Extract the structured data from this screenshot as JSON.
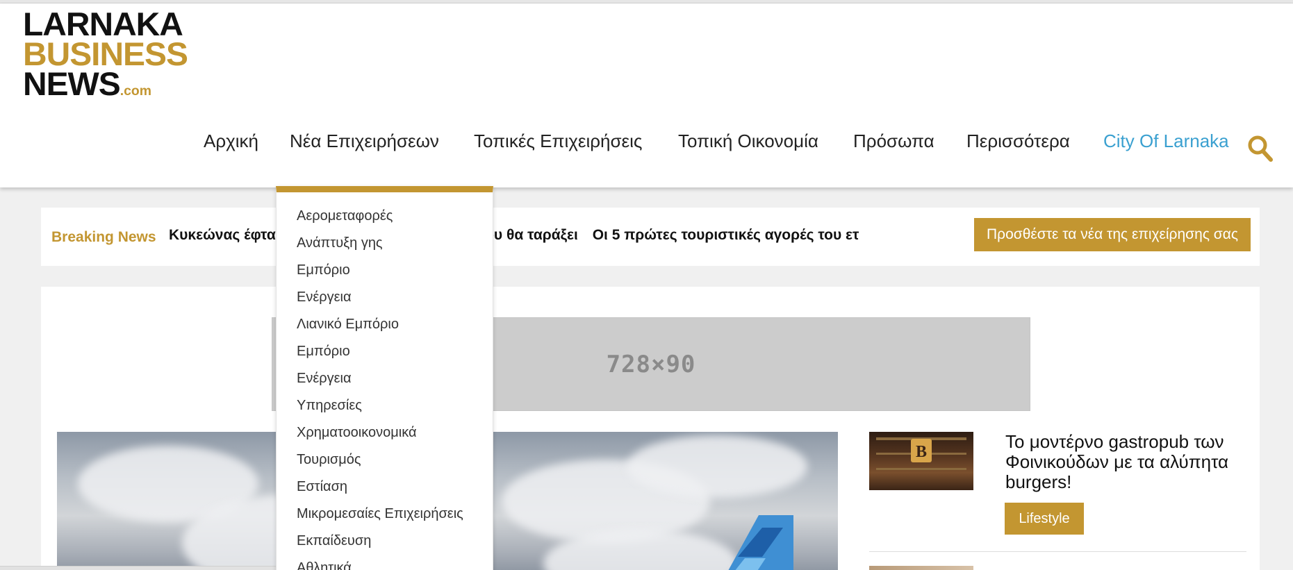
{
  "logo": {
    "line1": "LARNAKA",
    "line2": "BUSINESS",
    "line3": "NEWS",
    "suffix": ".com"
  },
  "nav": {
    "items": [
      "Αρχική",
      "Νέα Επιχειρήσεων",
      "Τοπικές Επιχειρήσεις",
      "Τοπική Οικονομία",
      "Πρόσωπα",
      "Περισσότερα",
      "City Of Larnaka"
    ],
    "search_icon": "search-icon"
  },
  "dropdown": {
    "items": [
      "Αερομεταφορές",
      "Ανάπτυξη γης",
      "Εμπόριο",
      "Ενέργεια",
      "Λιανικό Εμπόριο",
      "Εμπόριο",
      "Ενέργεια",
      "Υπηρεσίες",
      "Χρηματοοικονομικά",
      "Τουρισμός",
      "Εστίαση",
      "Μικρομεσαίες Επιχειρήσεις",
      "Εκπαίδευση",
      "Αθλητικά"
    ]
  },
  "breaking": {
    "label": "Breaking News",
    "headlines": [
      "Κυκεώνας έφτα",
      "έα άφιξη που θα ταράξει",
      "Οι 5 πρώτες τουριστικές αγορές του ετ"
    ],
    "add_button": "Προσθέστε τα νέα της επιχείρησης σας"
  },
  "ad": {
    "text": "728×90"
  },
  "sidebar": {
    "article1": {
      "title": "Το μοντέρνο gastropub των Φοινικούδων με τα αλύπητα burgers!",
      "tag": "Lifestyle"
    }
  },
  "colors": {
    "accent": "#c39631",
    "link": "#3aa0d0",
    "text": "#222222"
  }
}
